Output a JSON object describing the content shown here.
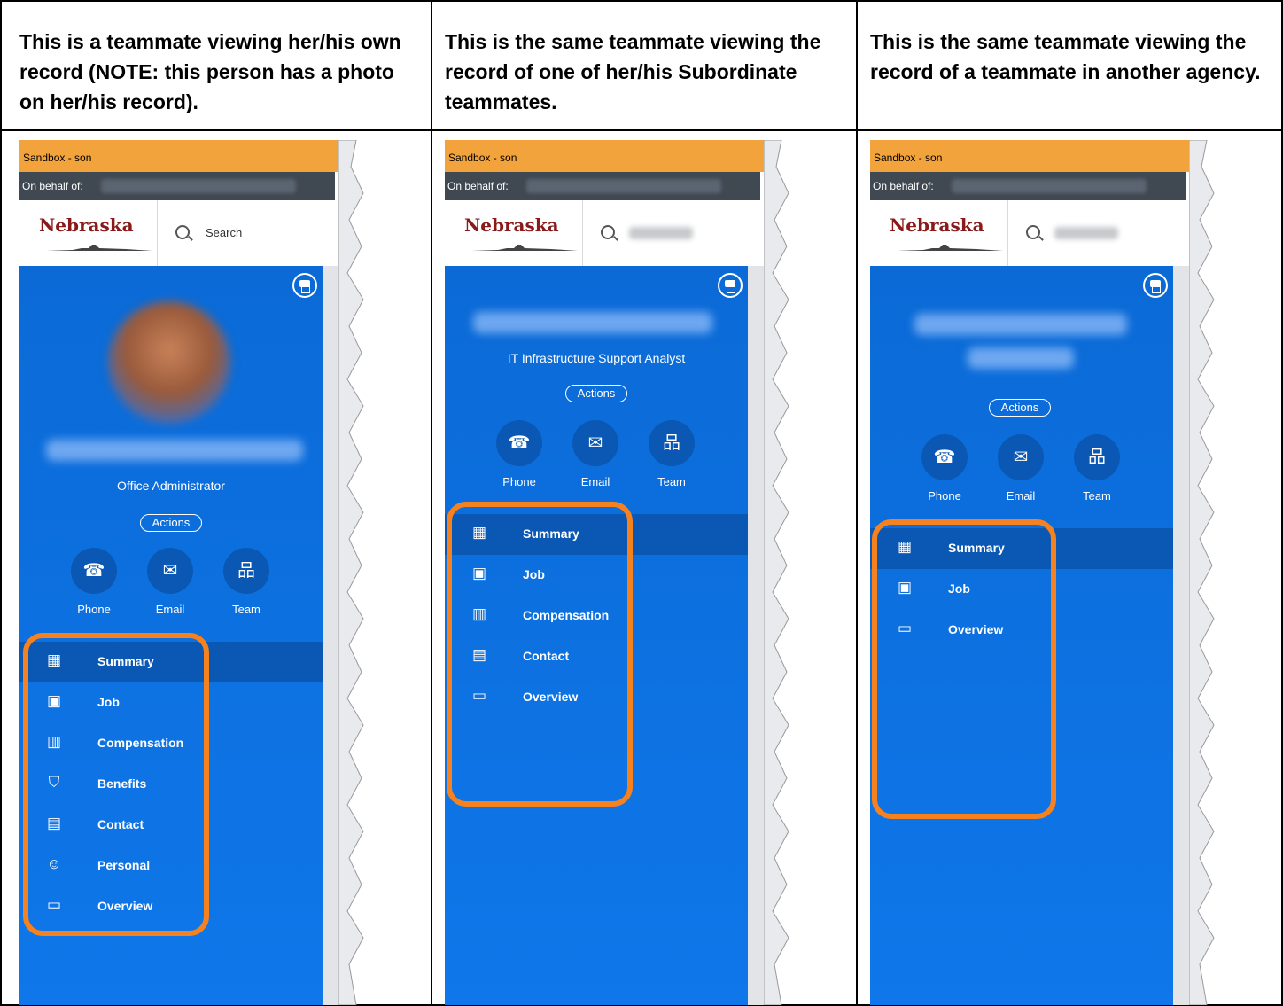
{
  "columns": [
    {
      "header": "This is a teammate viewing her/his own record (NOTE: this person has a photo on her/his record).",
      "env_label": "Sandbox -  son",
      "proxy_label": "On behalf of:",
      "logo": "Nebraska",
      "search_placeholder": "Search",
      "job_title": "Office Administrator",
      "actions_label": "Actions",
      "quick_actions": [
        {
          "label": "Phone",
          "icon": "phone-icon"
        },
        {
          "label": "Email",
          "icon": "email-icon"
        },
        {
          "label": "Team",
          "icon": "team-icon"
        }
      ],
      "menu": [
        {
          "label": "Summary",
          "icon": "summary-icon"
        },
        {
          "label": "Job",
          "icon": "job-icon"
        },
        {
          "label": "Compensation",
          "icon": "compensation-icon"
        },
        {
          "label": "Benefits",
          "icon": "benefits-icon"
        },
        {
          "label": "Contact",
          "icon": "contact-icon"
        },
        {
          "label": "Personal",
          "icon": "personal-icon"
        },
        {
          "label": "Overview",
          "icon": "overview-icon"
        }
      ],
      "selected_menu": "Summary"
    },
    {
      "header": "This is the same teammate viewing the record of one of her/his Subordinate teammates.",
      "env_label": "Sandbox -  son",
      "proxy_label": "On behalf of:",
      "logo": "Nebraska",
      "job_title": "IT Infrastructure Support Analyst",
      "actions_label": "Actions",
      "quick_actions": [
        {
          "label": "Phone",
          "icon": "phone-icon"
        },
        {
          "label": "Email",
          "icon": "email-icon"
        },
        {
          "label": "Team",
          "icon": "team-icon"
        }
      ],
      "menu": [
        {
          "label": "Summary",
          "icon": "summary-icon"
        },
        {
          "label": "Job",
          "icon": "job-icon"
        },
        {
          "label": "Compensation",
          "icon": "compensation-icon"
        },
        {
          "label": "Contact",
          "icon": "contact-icon"
        },
        {
          "label": "Overview",
          "icon": "overview-icon"
        }
      ],
      "selected_menu": "Summary"
    },
    {
      "header": "This is the same teammate viewing the record of a teammate in another agency.",
      "env_label": "Sandbox -  son",
      "proxy_label": "On behalf of:",
      "logo": "Nebraska",
      "actions_label": "Actions",
      "quick_actions": [
        {
          "label": "Phone",
          "icon": "phone-icon"
        },
        {
          "label": "Email",
          "icon": "email-icon"
        },
        {
          "label": "Team",
          "icon": "team-icon"
        }
      ],
      "menu": [
        {
          "label": "Summary",
          "icon": "summary-icon"
        },
        {
          "label": "Job",
          "icon": "job-icon"
        },
        {
          "label": "Overview",
          "icon": "overview-icon"
        }
      ],
      "selected_menu": "Summary"
    }
  ],
  "colors": {
    "env_bar": "#f3a33b",
    "proxy_bar": "#404852",
    "panel_blue": "#0b6ad6",
    "selected_row": "#0a58b4",
    "highlight_orange": "#f5821f",
    "logo_red": "#8a1a1a"
  }
}
